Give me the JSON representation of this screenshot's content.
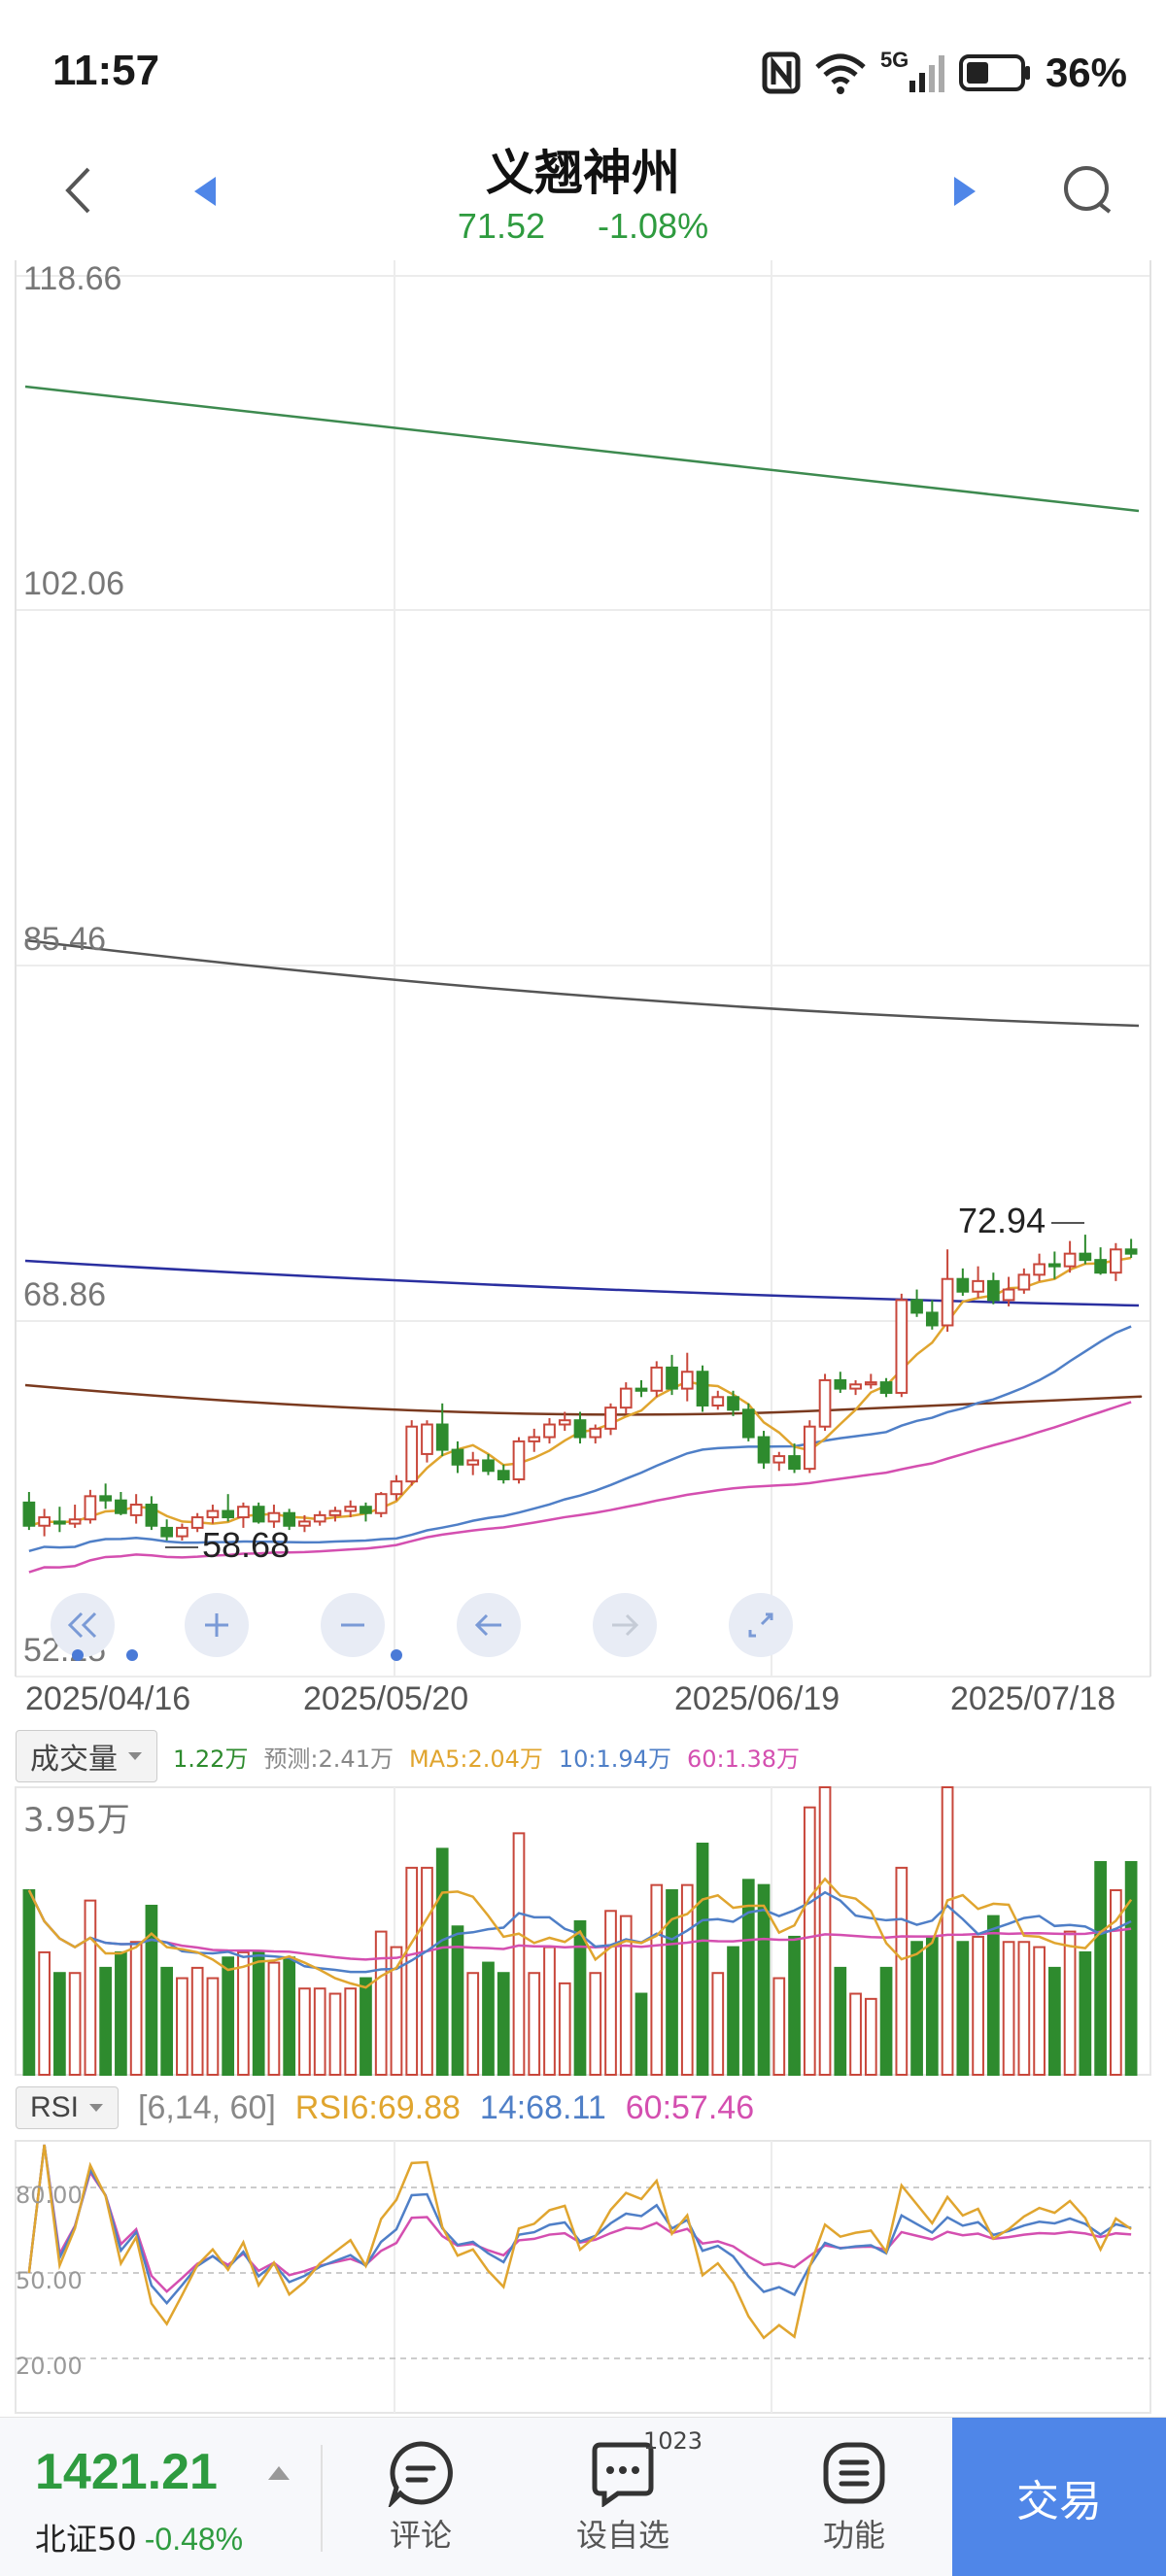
{
  "status": {
    "time": "11:57",
    "network": "5G",
    "battery": "36%"
  },
  "header": {
    "title": "义翘神州",
    "price": "71.52",
    "change": "-1.08%"
  },
  "price_axis": {
    "p1": "118.66",
    "p2": "102.06",
    "p3": "85.46",
    "p4": "68.86",
    "p5": "52.25"
  },
  "annotations": {
    "high": "72.94",
    "low": "58.68"
  },
  "dates": [
    "2025/04/16",
    "2025/05/20",
    "2025/06/19",
    "2025/07/18"
  ],
  "volume": {
    "dropdown": "成交量",
    "current": "1.22万",
    "forecast": "预测:2.41万",
    "ma5": "MA5:2.04万",
    "ma10": "10:1.94万",
    "ma60": "60:1.38万",
    "max_label": "3.95万"
  },
  "rsi": {
    "dropdown": "RSI",
    "params": "[6,14, 60]",
    "rsi6": "RSI6:69.88",
    "rsi14": "14:68.11",
    "rsi60": "60:57.46",
    "levels": [
      "80.00",
      "50.00",
      "20.00"
    ]
  },
  "bottom": {
    "index_value": "1421.21",
    "index_name": "北证50",
    "index_change": "-0.48%",
    "tab_comment": "评论",
    "tab_watch": "设自选",
    "tab_watch_badge": "1023",
    "tab_func": "功能",
    "trade": "交易"
  },
  "colors": {
    "up": "#c8473b",
    "down": "#2e8b2e",
    "ma5": "#e0a52f",
    "ma10": "#4f7fc7",
    "ma60": "#d44fb0",
    "accent": "#4f86e8"
  },
  "chart_data": {
    "type": "candlestick",
    "y_range": [
      52.25,
      118.66
    ],
    "candles": [
      [
        60.5,
        61.0,
        59.2,
        59.4
      ],
      [
        59.4,
        60.2,
        58.9,
        59.8
      ],
      [
        59.6,
        60.3,
        59.1,
        59.5
      ],
      [
        59.5,
        60.4,
        59.3,
        59.7
      ],
      [
        59.7,
        61.1,
        59.5,
        60.8
      ],
      [
        60.8,
        61.4,
        60.2,
        60.6
      ],
      [
        60.6,
        61.0,
        59.9,
        60.0
      ],
      [
        59.9,
        60.9,
        59.5,
        60.4
      ],
      [
        60.4,
        60.8,
        59.2,
        59.4
      ],
      [
        59.3,
        59.7,
        58.7,
        58.9
      ],
      [
        58.9,
        59.5,
        58.7,
        59.3
      ],
      [
        59.3,
        60.0,
        59.1,
        59.8
      ],
      [
        59.8,
        60.4,
        59.5,
        60.1
      ],
      [
        60.1,
        60.9,
        59.6,
        59.8
      ],
      [
        59.8,
        60.5,
        59.3,
        60.3
      ],
      [
        60.3,
        60.5,
        59.5,
        59.6
      ],
      [
        59.6,
        60.4,
        59.3,
        60.0
      ],
      [
        60.0,
        60.2,
        59.2,
        59.4
      ],
      [
        59.4,
        59.9,
        59.1,
        59.6
      ],
      [
        59.6,
        60.1,
        59.4,
        59.9
      ],
      [
        59.9,
        60.3,
        59.6,
        60.1
      ],
      [
        60.1,
        60.6,
        59.8,
        60.3
      ],
      [
        60.3,
        60.5,
        59.6,
        60.0
      ],
      [
        60.0,
        61.0,
        59.8,
        60.9
      ],
      [
        60.9,
        61.8,
        60.6,
        61.5
      ],
      [
        61.5,
        64.4,
        61.3,
        64.1
      ],
      [
        62.8,
        64.4,
        62.4,
        64.2
      ],
      [
        64.2,
        65.2,
        62.7,
        63.0
      ],
      [
        63.0,
        63.4,
        61.9,
        62.3
      ],
      [
        62.3,
        62.9,
        61.8,
        62.5
      ],
      [
        62.5,
        62.8,
        61.8,
        62.0
      ],
      [
        62.0,
        62.3,
        61.4,
        61.6
      ],
      [
        61.6,
        63.6,
        61.4,
        63.4
      ],
      [
        63.4,
        64.0,
        62.9,
        63.6
      ],
      [
        63.6,
        64.5,
        63.3,
        64.2
      ],
      [
        64.2,
        64.8,
        63.9,
        64.4
      ],
      [
        64.4,
        64.8,
        63.3,
        63.6
      ],
      [
        63.6,
        64.2,
        63.3,
        64.0
      ],
      [
        64.0,
        65.2,
        63.7,
        65.0
      ],
      [
        65.0,
        66.2,
        64.7,
        65.9
      ],
      [
        65.9,
        66.3,
        65.5,
        65.8
      ],
      [
        65.8,
        67.2,
        65.5,
        66.9
      ],
      [
        66.9,
        67.5,
        65.6,
        65.9
      ],
      [
        65.9,
        67.6,
        65.3,
        66.7
      ],
      [
        66.7,
        67.0,
        64.8,
        65.1
      ],
      [
        65.1,
        65.8,
        64.9,
        65.5
      ],
      [
        65.5,
        65.8,
        64.6,
        64.9
      ],
      [
        64.9,
        65.2,
        63.4,
        63.6
      ],
      [
        63.6,
        63.9,
        62.1,
        62.4
      ],
      [
        62.4,
        62.9,
        62.0,
        62.7
      ],
      [
        62.7,
        63.3,
        61.9,
        62.1
      ],
      [
        62.1,
        64.4,
        61.9,
        64.1
      ],
      [
        64.1,
        66.6,
        63.9,
        66.3
      ],
      [
        66.3,
        66.7,
        65.7,
        65.9
      ],
      [
        65.9,
        66.3,
        65.6,
        66.1
      ],
      [
        66.1,
        66.6,
        65.9,
        66.2
      ],
      [
        66.2,
        66.4,
        65.5,
        65.7
      ],
      [
        65.7,
        70.4,
        65.5,
        70.1
      ],
      [
        70.1,
        70.6,
        69.3,
        69.5
      ],
      [
        69.5,
        70.1,
        68.7,
        68.9
      ],
      [
        68.9,
        72.5,
        68.6,
        71.1
      ],
      [
        71.1,
        71.6,
        70.3,
        70.5
      ],
      [
        70.5,
        71.7,
        70.2,
        71.0
      ],
      [
        71.0,
        71.4,
        69.9,
        70.1
      ],
      [
        70.1,
        71.2,
        69.8,
        70.6
      ],
      [
        70.6,
        71.6,
        70.4,
        71.3
      ],
      [
        71.3,
        72.3,
        71.0,
        71.8
      ],
      [
        71.8,
        72.4,
        71.1,
        71.7
      ],
      [
        71.7,
        72.9,
        71.4,
        72.3
      ],
      [
        72.3,
        73.2,
        71.8,
        72.0
      ],
      [
        72.0,
        72.6,
        71.3,
        71.4
      ],
      [
        71.4,
        72.8,
        71.0,
        72.5
      ],
      [
        72.5,
        73.0,
        72.1,
        72.3
      ]
    ],
    "ma_lines": [
      {
        "name": "MA5",
        "color": "#e0a52f"
      },
      {
        "name": "MA10",
        "color": "#4f7fc7"
      },
      {
        "name": "MA60",
        "color": "#d44fb0"
      }
    ],
    "volume_max": "3.95万",
    "rsi_levels": [
      80,
      50,
      20
    ]
  }
}
